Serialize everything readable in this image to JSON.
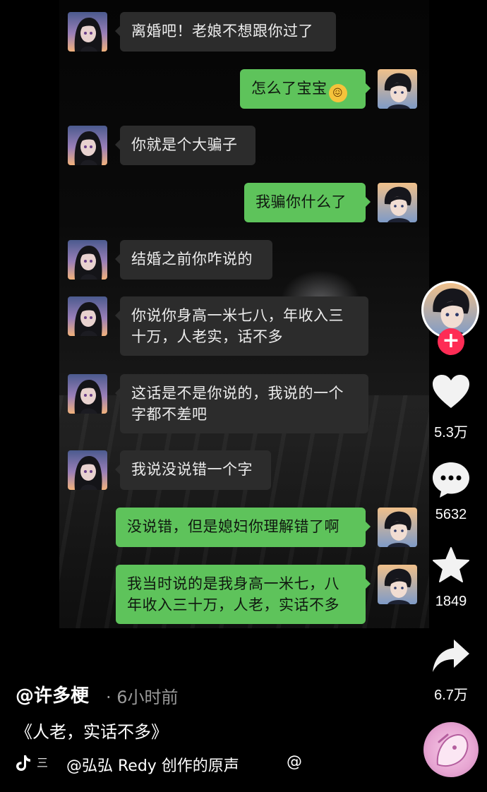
{
  "chat": {
    "messages": [
      {
        "side": "in",
        "text": "离婚吧！老娘不想跟你过了"
      },
      {
        "side": "out",
        "text": "怎么了宝宝",
        "emoji": "😖"
      },
      {
        "side": "in",
        "text": "你就是个大骗子"
      },
      {
        "side": "out",
        "text": "我骗你什么了"
      },
      {
        "side": "in",
        "text": "结婚之前你咋说的"
      },
      {
        "side": "in",
        "line1": "你说你身高一米七八，年收入三",
        "line2": "十万，人老实，话不多"
      },
      {
        "side": "in",
        "line1": "这话是不是你说的，我说的一个",
        "line2": "字都不差吧"
      },
      {
        "side": "in",
        "text": "我说没说错一个字"
      },
      {
        "side": "out",
        "text": "没说错，但是媳妇你理解错了啊"
      },
      {
        "side": "out",
        "line1": "我当时说的是我身高一米七，八",
        "line2": "年收入三十万，人老，实话不多"
      }
    ],
    "colors": {
      "incoming": "#2c2c2c",
      "outgoing": "#5ec35b"
    }
  },
  "rail": {
    "follow": "+",
    "likes": "5.3万",
    "comments": "5632",
    "favorites": "1849",
    "shares": "6.7万",
    "icons": [
      "heart-icon",
      "comment-icon",
      "star-icon",
      "share-icon"
    ]
  },
  "info": {
    "author": "@许多梗",
    "time": "· 6小时前",
    "caption": "《人老，实话不多》",
    "music_lines": "三",
    "music_title": "@弘弘 Redy 创作的原声",
    "music_trailing": "@"
  }
}
